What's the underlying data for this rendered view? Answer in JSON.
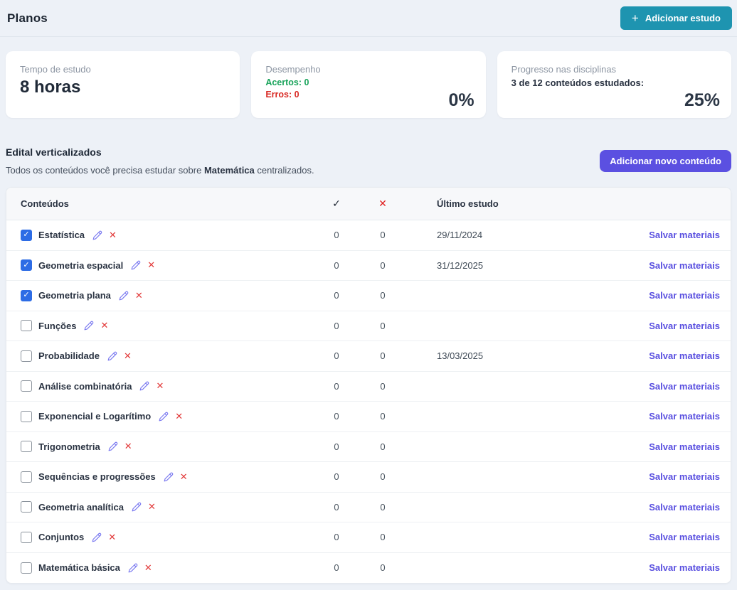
{
  "page": {
    "title": "Planos"
  },
  "header": {
    "add_study_button": "Adicionar estudo",
    "plus_icon": "+"
  },
  "cards": {
    "study_time": {
      "label": "Tempo de estudo",
      "value": "8 horas"
    },
    "performance": {
      "label": "Desempenho",
      "acertos": "Acertos: 0",
      "erros": "Erros: 0",
      "percent": "0%"
    },
    "progress": {
      "label": "Progresso nas disciplinas",
      "summary": "3 de 12 conteúdos estudados:",
      "percent": "25%"
    }
  },
  "section": {
    "title": "Edital verticalizados",
    "description_prefix": "Todos os conteúdos você precisa estudar sobre ",
    "description_bold": "Matemática",
    "description_suffix": " centralizados.",
    "add_content_button": "Adicionar novo conteúdo"
  },
  "table": {
    "headers": {
      "contents": "Conteúdos",
      "check_icon": "✓",
      "x_icon": "✕",
      "last_study": "Último estudo"
    },
    "icons": {
      "check": "✓",
      "delete": "✕"
    },
    "row_link_label": "Salvar materiais",
    "rows": [
      {
        "label": "Estatística",
        "checked": true,
        "correct": "0",
        "wrong": "0",
        "last_study": "29/11/2024"
      },
      {
        "label": "Geometria espacial",
        "checked": true,
        "correct": "0",
        "wrong": "0",
        "last_study": "31/12/2025"
      },
      {
        "label": "Geometria plana",
        "checked": true,
        "correct": "0",
        "wrong": "0",
        "last_study": ""
      },
      {
        "label": "Funções",
        "checked": false,
        "correct": "0",
        "wrong": "0",
        "last_study": ""
      },
      {
        "label": "Probabilidade",
        "checked": false,
        "correct": "0",
        "wrong": "0",
        "last_study": "13/03/2025"
      },
      {
        "label": "Análise combinatória",
        "checked": false,
        "correct": "0",
        "wrong": "0",
        "last_study": ""
      },
      {
        "label": "Exponencial e Logarítimo",
        "checked": false,
        "correct": "0",
        "wrong": "0",
        "last_study": ""
      },
      {
        "label": "Trigonometria",
        "checked": false,
        "correct": "0",
        "wrong": "0",
        "last_study": ""
      },
      {
        "label": "Sequências e progressões",
        "checked": false,
        "correct": "0",
        "wrong": "0",
        "last_study": ""
      },
      {
        "label": "Geometria analítica",
        "checked": false,
        "correct": "0",
        "wrong": "0",
        "last_study": ""
      },
      {
        "label": "Conjuntos",
        "checked": false,
        "correct": "0",
        "wrong": "0",
        "last_study": ""
      },
      {
        "label": "Matemática básica",
        "checked": false,
        "correct": "0",
        "wrong": "0",
        "last_study": ""
      }
    ]
  },
  "colors": {
    "page_background": "#edf1f7",
    "teal_button": "#1e94b0",
    "purple_button": "#5b50e1",
    "link_purple": "#5a50e0",
    "checkbox_blue": "#2d6ce5",
    "green_text": "#18a35a",
    "red_text": "#d92b25"
  }
}
